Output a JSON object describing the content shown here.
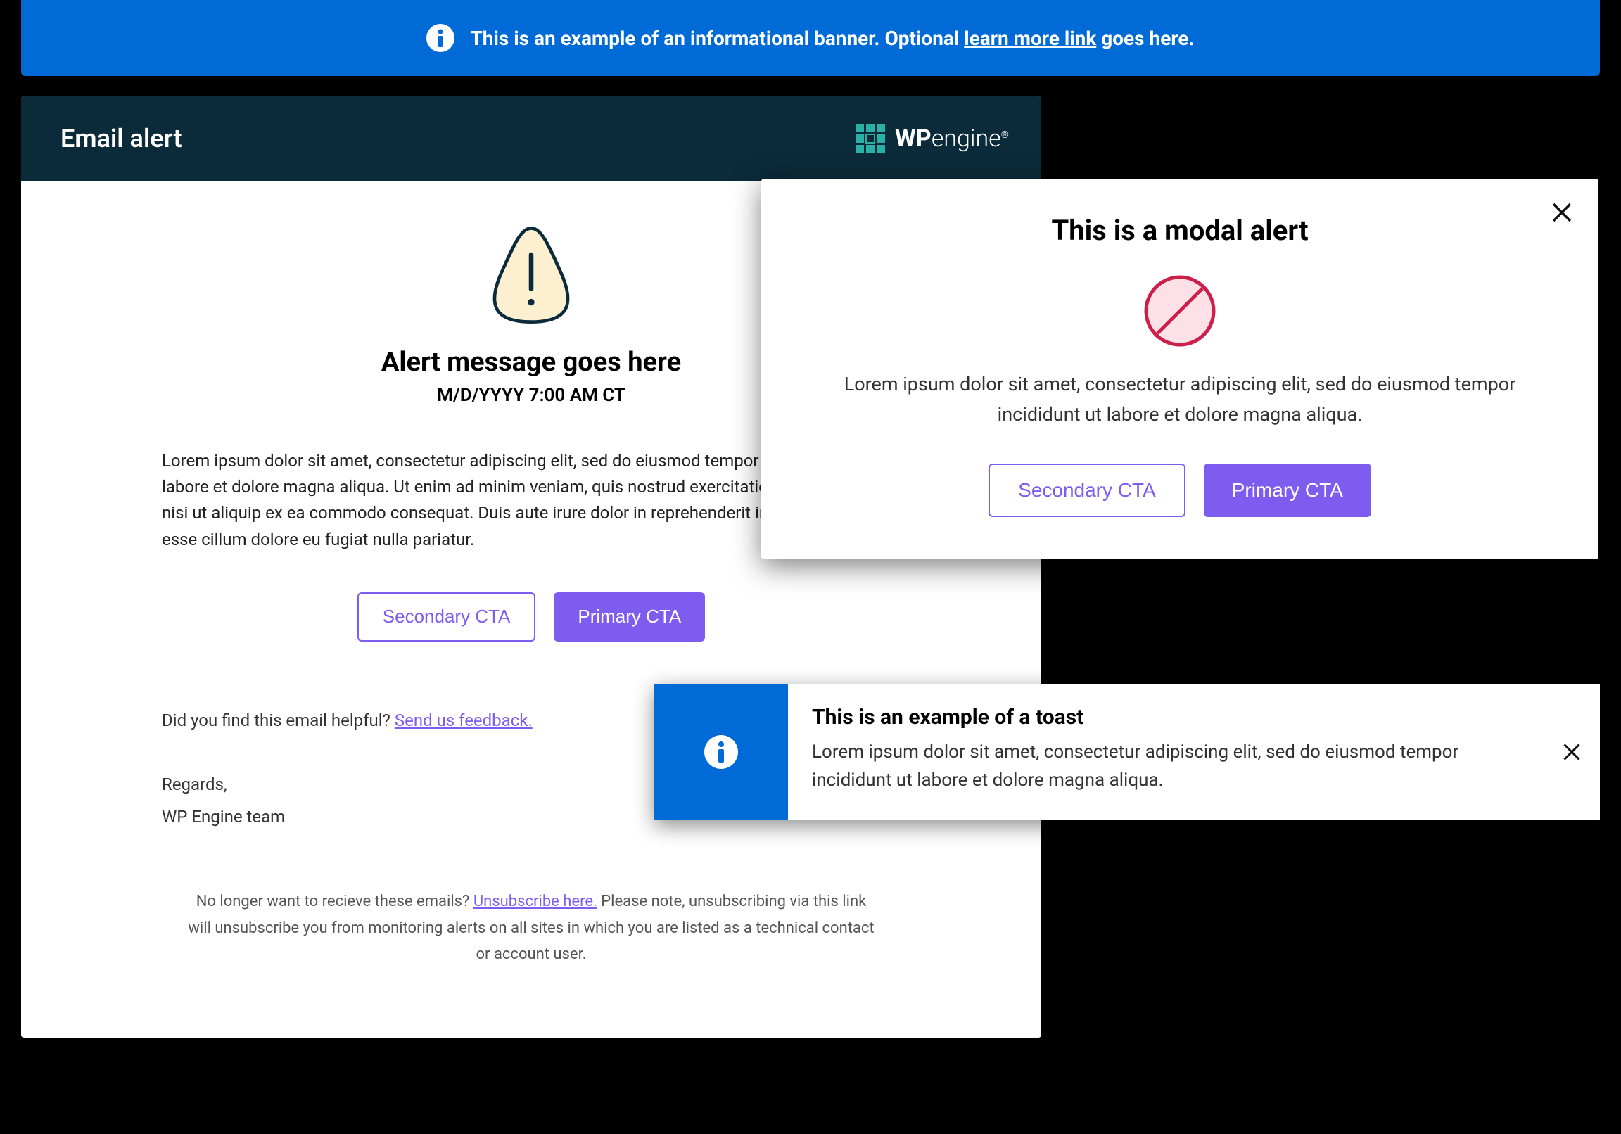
{
  "banner": {
    "text_prefix": "This is an example of an informational banner. Optional ",
    "link_text": "learn more link",
    "text_suffix": " goes here."
  },
  "email": {
    "header_title": "Email alert",
    "logo_brand_bold": "WP",
    "logo_brand_light": "engine",
    "alert_title": "Alert message goes here",
    "alert_date": "M/D/YYYY 7:00 AM CT",
    "body_text": "Lorem ipsum dolor sit amet, consectetur adipiscing elit, sed do eiusmod tempor incididunt ut labore et dolore magna aliqua. Ut enim ad minim veniam, quis nostrud exercitation ullamco laboris nisi ut aliquip ex ea commodo consequat. Duis aute irure dolor in reprehenderit in voluptate velit esse cillum dolore eu fugiat nulla pariatur.",
    "secondary_cta": "Secondary CTA",
    "primary_cta": "Primary CTA",
    "feedback_prefix": "Did you find this email helpful? ",
    "feedback_link": "Send us feedback.",
    "regards": "Regards,",
    "team": "WP Engine team",
    "unsub_prefix": "No longer want to recieve these emails? ",
    "unsub_link": "Unsubscribe here.",
    "unsub_suffix": " Please note, unsubscribing via this link will unsubscribe you from monitoring alerts on all sites in which you are listed as a technical contact or account user."
  },
  "modal": {
    "title": "This is a modal alert",
    "text": "Lorem ipsum dolor sit amet, consectetur adipiscing elit, sed do eiusmod tempor incididunt ut labore et dolore magna aliqua.",
    "secondary_cta": "Secondary CTA",
    "primary_cta": "Primary CTA"
  },
  "toast": {
    "title": "This is an example of a toast",
    "text": "Lorem ipsum dolor sit amet, consectetur adipiscing elit, sed do eiusmod tempor incididunt ut labore et dolore magna aliqua."
  }
}
